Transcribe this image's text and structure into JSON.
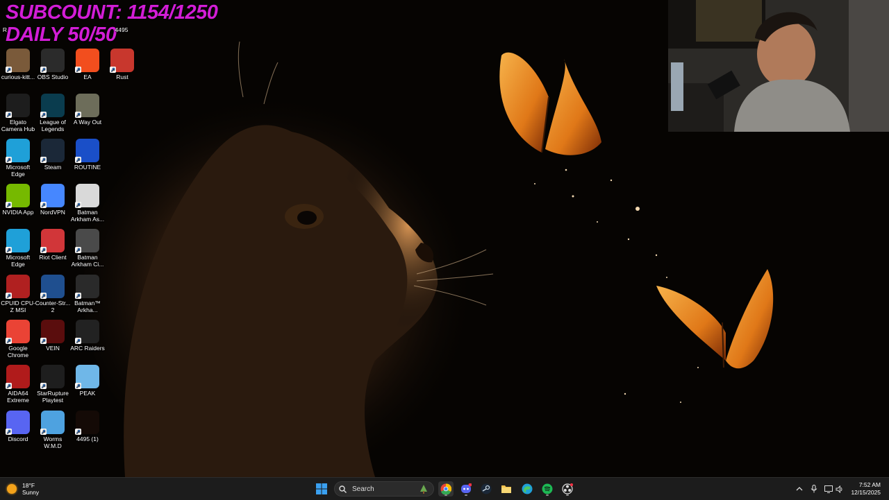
{
  "overlay": {
    "subcount": "SUBCOUNT: 1154/1250",
    "daily": "DAILY 50/50"
  },
  "desktop": {
    "top_row_partial": [
      "R",
      "4495"
    ],
    "icons": [
      {
        "label": "curious-kitt...",
        "icon": "image-file-icon",
        "color": "#7a5a3a"
      },
      {
        "label": "OBS Studio",
        "icon": "obs-icon",
        "color": "#2b2b2b"
      },
      {
        "label": "EA",
        "icon": "ea-icon",
        "color": "#f24e1e"
      },
      {
        "label": "Rust",
        "icon": "rust-icon",
        "color": "#c8372d"
      },
      {
        "label": "Elgato Camera Hub",
        "icon": "elgato-camera-icon",
        "color": "#1d1d1d"
      },
      {
        "label": "League of Legends",
        "icon": "league-icon",
        "color": "#0a3c4e"
      },
      {
        "label": "A Way Out",
        "icon": "a-way-out-icon",
        "color": "#6d6d5a"
      },
      {
        "label": "Microsoft Edge",
        "icon": "edge-icon",
        "color": "#1fa0d8"
      },
      {
        "label": "Steam",
        "icon": "steam-icon",
        "color": "#1b2838"
      },
      {
        "label": "ROUTINE",
        "icon": "routine-icon",
        "color": "#1a4fc8"
      },
      {
        "label": "NVIDIA App",
        "icon": "nvidia-icon",
        "color": "#76b900"
      },
      {
        "label": "NordVPN",
        "icon": "nordvpn-icon",
        "color": "#4687ff"
      },
      {
        "label": "Batman Arkham As...",
        "icon": "batman-asylum-icon",
        "color": "#d9d9d9"
      },
      {
        "label": "Microsoft Edge",
        "icon": "edge-icon",
        "color": "#1fa0d8"
      },
      {
        "label": "Riot Client",
        "icon": "riot-icon",
        "color": "#d13639"
      },
      {
        "label": "Batman Arkham Ci...",
        "icon": "batman-city-icon",
        "color": "#4a4a4a"
      },
      {
        "label": "CPUID CPU-Z MSI",
        "icon": "cpuz-icon",
        "color": "#b02020"
      },
      {
        "label": "Counter-Str... 2",
        "icon": "cs2-icon",
        "color": "#1f4f8f"
      },
      {
        "label": "Batman™ Arkha...",
        "icon": "batman-knight-icon",
        "color": "#2a2a2a"
      },
      {
        "label": "Google Chrome",
        "icon": "chrome-icon",
        "color": "#ea4335"
      },
      {
        "label": "VEIN",
        "icon": "vein-icon",
        "color": "#5a0d0d"
      },
      {
        "label": "ARC Raiders",
        "icon": "arc-raiders-icon",
        "color": "#222222"
      },
      {
        "label": "AIDA64 Extreme",
        "icon": "aida64-icon",
        "color": "#b01b1b"
      },
      {
        "label": "StarRupture Playtest",
        "icon": "starrupture-icon",
        "color": "#1e1e1e"
      },
      {
        "label": "PEAK",
        "icon": "peak-icon",
        "color": "#6fb7e8"
      },
      {
        "label": "Discord",
        "icon": "discord-icon",
        "color": "#5865f2"
      },
      {
        "label": "Worms W.M.D",
        "icon": "worms-icon",
        "color": "#4ea2e0"
      },
      {
        "label": "4495 (1)",
        "icon": "image-file-icon",
        "color": "#140a06"
      }
    ]
  },
  "taskbar": {
    "weather": {
      "temp": "18°F",
      "condition": "Sunny"
    },
    "search_label": "Search",
    "apps": [
      "start-icon",
      "chrome-icon",
      "discord-icon",
      "steam-icon",
      "file-explorer-icon",
      "edge-icon",
      "spotify-icon",
      "obs-icon"
    ],
    "clock": {
      "time": "7:52 AM",
      "date": "12/15/2025"
    }
  }
}
